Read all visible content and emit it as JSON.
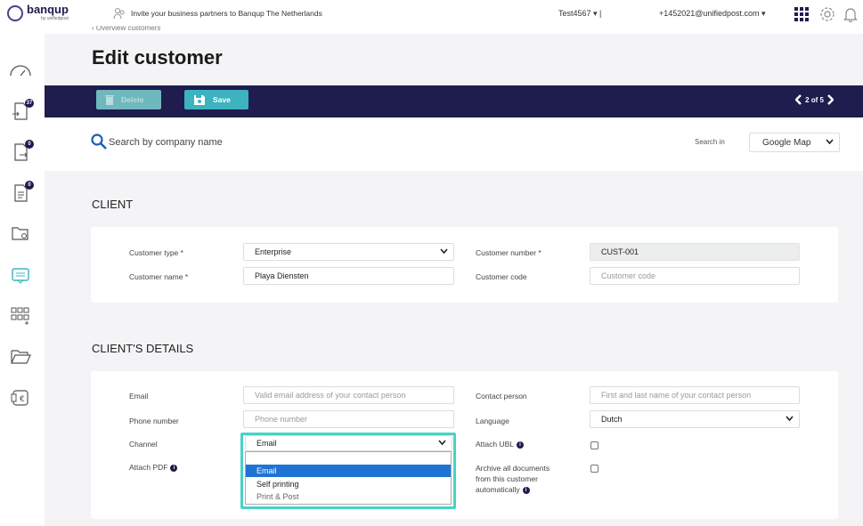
{
  "topbar": {
    "logo_text": "banqup",
    "logo_sub": "by unifiedpost",
    "invite_text": "Invite your business partners to Banqup The Netherlands",
    "tenant": "Test4567 ▾  |",
    "user": "+1452021@unifiedpost.com ▾"
  },
  "sidebar": {
    "badges": [
      "37",
      "0",
      "0"
    ]
  },
  "header": {
    "breadcrumb": "‹ Overview customers",
    "title": "Edit customer"
  },
  "actions": {
    "delete_label": "Delete",
    "save_label": "Save",
    "pager": "2 of 5"
  },
  "search": {
    "placeholder": "Search by company name",
    "search_in_label": "Search in",
    "search_in_value": "Google Map"
  },
  "client": {
    "section_title": "CLIENT",
    "customer_type_label": "Customer type *",
    "customer_type_value": "Enterprise",
    "customer_number_label": "Customer number *",
    "customer_number_value": "CUST-001",
    "customer_name_label": "Customer name *",
    "customer_name_value": "Playa Diensten",
    "customer_code_label": "Customer code",
    "customer_code_placeholder": "Customer code"
  },
  "details": {
    "section_title": "CLIENT'S DETAILS",
    "email_label": "Email",
    "email_placeholder": "Valid email address of your contact person",
    "contact_label": "Contact person",
    "contact_placeholder": "First and last name of your contact person",
    "phone_label": "Phone number",
    "phone_placeholder": "Phone number",
    "language_label": "Language",
    "language_value": "Dutch",
    "channel_label": "Channel",
    "channel_value": "Email",
    "attach_ubl_label": "Attach UBL",
    "attach_pdf_label": "Attach PDF",
    "archive_label_1": "Archive all documents",
    "archive_label_2": "from this customer",
    "archive_label_3": "automatically",
    "channel_options": [
      "Email",
      "Self printing",
      "Print & Post"
    ]
  },
  "colors": {
    "navy": "#1f1c4e",
    "teal": "#3db3c0",
    "highlight": "#47d3c6",
    "select_blue": "#1f73d2"
  }
}
